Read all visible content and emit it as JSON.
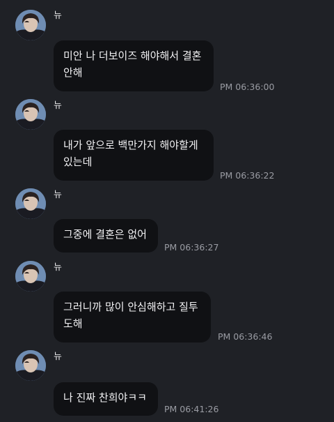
{
  "sender": {
    "name": "뉴",
    "avatar_icon": "profile-photo-avatar"
  },
  "messages": [
    {
      "text": "미안 나 더보이즈 해야해서 결혼 안해",
      "time": "PM 06:36:00"
    },
    {
      "text": "내가 앞으로 백만가지 해야할게 있는데",
      "time": "PM 06:36:22"
    },
    {
      "text": "그중에 결혼은 없어",
      "time": "PM 06:36:27"
    },
    {
      "text": "그러니까 많이 안심해하고 질투 도해",
      "time": "PM 06:36:46"
    },
    {
      "text": "나 진짜 찬희야ㅋㅋ",
      "time": "PM 06:41:26"
    }
  ],
  "colors": {
    "background": "#1f2126",
    "bubble": "#101114",
    "text": "#f2f2f4",
    "timestamp": "#9a9ca3"
  }
}
